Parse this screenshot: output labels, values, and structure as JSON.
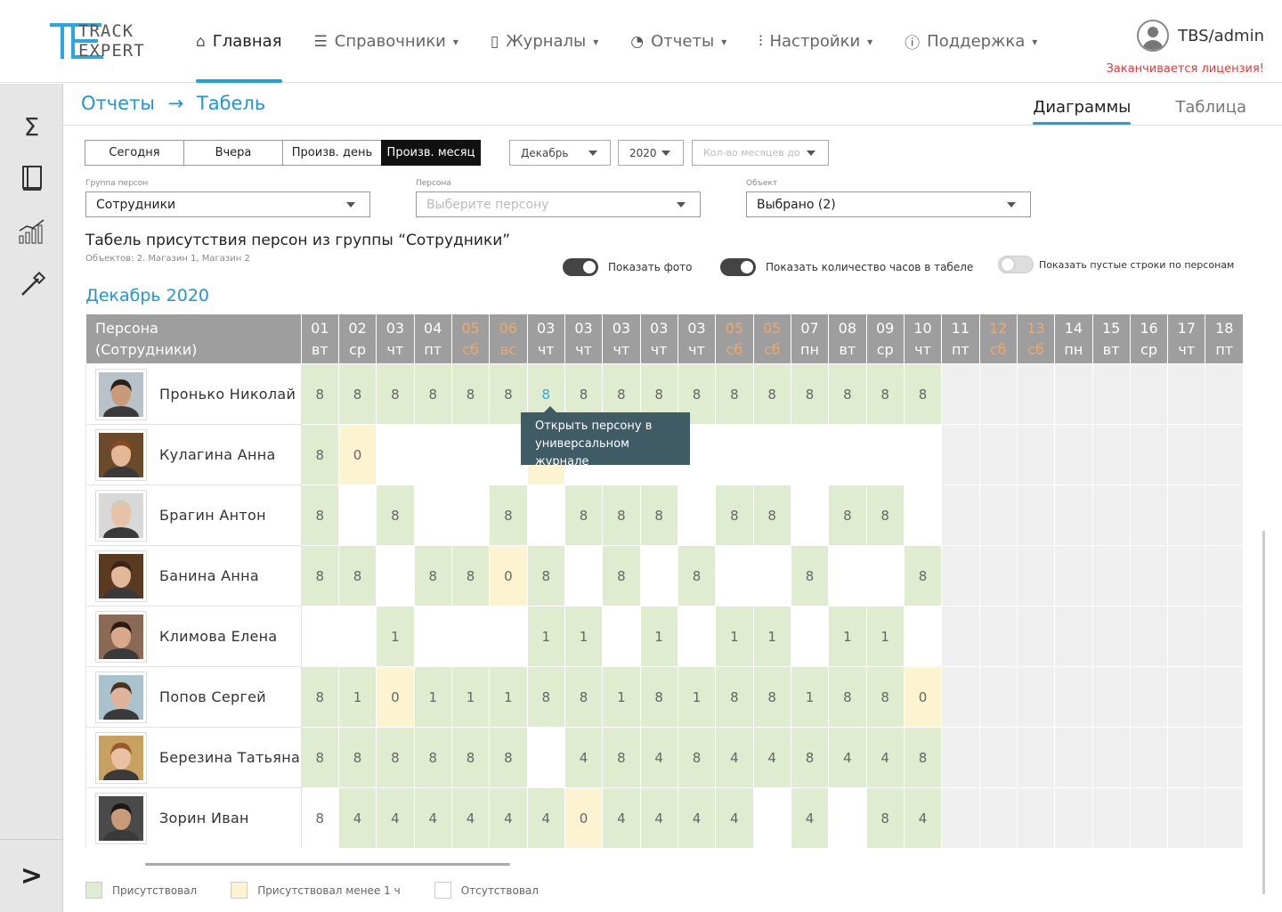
{
  "app": {
    "logo_line1": "TRACK",
    "logo_line2": "EXPERT",
    "user": "TBS/admin",
    "license_warning": "Заканчивается лицензия!"
  },
  "nav": [
    {
      "label": "Главная",
      "icon": "home-icon",
      "active": true
    },
    {
      "label": "Справочники",
      "icon": "list-icon"
    },
    {
      "label": "Журналы",
      "icon": "book-icon"
    },
    {
      "label": "Отчеты",
      "icon": "pie-chart-icon"
    },
    {
      "label": "Настройки",
      "icon": "sliders-icon"
    },
    {
      "label": "Поддержка",
      "icon": "help-icon"
    }
  ],
  "sidebar": [
    "sum-icon",
    "journal-icon",
    "analytics-icon",
    "tools-icon"
  ],
  "breadcrumb": {
    "part1": "Отчеты",
    "arrow": "→",
    "part2": "Табель"
  },
  "view_tabs": {
    "charts": "Диаграммы",
    "table": "Таблица"
  },
  "period_buttons": [
    "Сегодня",
    "Вчера",
    "Произв. день",
    "Произв. месяц"
  ],
  "filters": {
    "month": "Декабрь",
    "year": "2020",
    "months_count_placeholder": "Кол-во месяцев до",
    "group_label": "Группа персон",
    "group_value": "Сотрудники",
    "person_label": "Персона",
    "person_placeholder": "Выберите персону",
    "object_label": "Объект",
    "object_value": "Выбрано (2)"
  },
  "report": {
    "title": "Табель присутствия персон из группы “Сотрудники”",
    "subtitle": "Объектов: 2. Магазин 1, Магазин 2",
    "toggle_photo": "Показать фото",
    "toggle_hours": "Показать количество часов в табеле",
    "toggle_empty": "Показать пустые строки по персонам",
    "month_title": "Декабрь 2020"
  },
  "table": {
    "person_header_1": "Персона",
    "person_header_2": "(Сотрудники)",
    "columns": [
      {
        "d": "01",
        "w": "вт"
      },
      {
        "d": "02",
        "w": "ср"
      },
      {
        "d": "03",
        "w": "чт"
      },
      {
        "d": "04",
        "w": "пт"
      },
      {
        "d": "05",
        "w": "сб",
        "we": true
      },
      {
        "d": "06",
        "w": "вс",
        "we": true
      },
      {
        "d": "03",
        "w": "чт"
      },
      {
        "d": "03",
        "w": "чт"
      },
      {
        "d": "03",
        "w": "чт"
      },
      {
        "d": "03",
        "w": "чт"
      },
      {
        "d": "03",
        "w": "чт"
      },
      {
        "d": "05",
        "w": "сб",
        "we": true
      },
      {
        "d": "05",
        "w": "сб",
        "we": true
      },
      {
        "d": "07",
        "w": "пн"
      },
      {
        "d": "08",
        "w": "вт"
      },
      {
        "d": "09",
        "w": "ср"
      },
      {
        "d": "10",
        "w": "чт"
      },
      {
        "d": "11",
        "w": "пт"
      },
      {
        "d": "12",
        "w": "сб",
        "we": true
      },
      {
        "d": "13",
        "w": "сб",
        "we": true
      },
      {
        "d": "14",
        "w": "пн"
      },
      {
        "d": "15",
        "w": "вт"
      },
      {
        "d": "16",
        "w": "ср"
      },
      {
        "d": "17",
        "w": "чт"
      },
      {
        "d": "18",
        "w": "пт"
      }
    ],
    "rows": [
      {
        "name": "Пронько Николай",
        "cells": [
          [
            "8",
            "g"
          ],
          [
            "8",
            "g"
          ],
          [
            "8",
            "g"
          ],
          [
            "8",
            "g"
          ],
          [
            "8",
            "g"
          ],
          [
            "8",
            "g"
          ],
          [
            "8",
            "g"
          ],
          [
            "8",
            "g"
          ],
          [
            "8",
            "g"
          ],
          [
            "8",
            "g"
          ],
          [
            "8",
            "g"
          ],
          [
            "8",
            "g"
          ],
          [
            "8",
            "g"
          ],
          [
            "8",
            "g"
          ],
          [
            "8",
            "g"
          ],
          [
            "8",
            "g"
          ],
          [
            "8",
            "g"
          ]
        ]
      },
      {
        "name": "Кулагина Анна",
        "cells": [
          [
            "8",
            "g"
          ],
          [
            "0",
            "y"
          ],
          [
            "",
            "w"
          ],
          [
            "",
            "w"
          ],
          [
            "",
            "w"
          ],
          [
            "",
            "w"
          ],
          [
            "",
            "y"
          ],
          [
            "",
            "w"
          ],
          [
            "",
            "w"
          ],
          [
            "",
            "w"
          ],
          [
            "",
            "w"
          ],
          [
            "",
            "w"
          ],
          [
            "",
            "w"
          ],
          [
            "",
            "w"
          ],
          [
            "",
            "w"
          ],
          [
            "",
            "w"
          ],
          [
            "",
            "w"
          ]
        ]
      },
      {
        "name": "Брагин Антон",
        "cells": [
          [
            "8",
            "g"
          ],
          [
            "",
            "w"
          ],
          [
            "8",
            "g"
          ],
          [
            "",
            "w"
          ],
          [
            "",
            "w"
          ],
          [
            "8",
            "g"
          ],
          [
            "",
            "w"
          ],
          [
            "8",
            "g"
          ],
          [
            "8",
            "g"
          ],
          [
            "8",
            "g"
          ],
          [
            "",
            "w"
          ],
          [
            "8",
            "g"
          ],
          [
            "8",
            "g"
          ],
          [
            "",
            "w"
          ],
          [
            "8",
            "g"
          ],
          [
            "8",
            "g"
          ],
          [
            "",
            "w"
          ]
        ]
      },
      {
        "name": "Банина Анна",
        "cells": [
          [
            "8",
            "g"
          ],
          [
            "8",
            "g"
          ],
          [
            "",
            "w"
          ],
          [
            "8",
            "g"
          ],
          [
            "8",
            "g"
          ],
          [
            "0",
            "y"
          ],
          [
            "8",
            "g"
          ],
          [
            "",
            "w"
          ],
          [
            "8",
            "g"
          ],
          [
            "",
            "w"
          ],
          [
            "8",
            "g"
          ],
          [
            "",
            "w"
          ],
          [
            "",
            "w"
          ],
          [
            "8",
            "g"
          ],
          [
            "",
            "w"
          ],
          [
            "",
            "w"
          ],
          [
            "8",
            "g"
          ]
        ]
      },
      {
        "name": "Климова Елена",
        "cells": [
          [
            "",
            "w"
          ],
          [
            "",
            "w"
          ],
          [
            "1",
            "g"
          ],
          [
            "",
            "w"
          ],
          [
            "",
            "w"
          ],
          [
            "",
            "w"
          ],
          [
            "1",
            "g"
          ],
          [
            "1",
            "g"
          ],
          [
            "",
            "w"
          ],
          [
            "1",
            "g"
          ],
          [
            "",
            "w"
          ],
          [
            "1",
            "g"
          ],
          [
            "1",
            "g"
          ],
          [
            "",
            "w"
          ],
          [
            "1",
            "g"
          ],
          [
            "1",
            "g"
          ],
          [
            "",
            "w"
          ]
        ]
      },
      {
        "name": "Попов Сергей",
        "cells": [
          [
            "8",
            "g"
          ],
          [
            "1",
            "g"
          ],
          [
            "0",
            "y"
          ],
          [
            "1",
            "g"
          ],
          [
            "1",
            "g"
          ],
          [
            "1",
            "g"
          ],
          [
            "8",
            "g"
          ],
          [
            "8",
            "g"
          ],
          [
            "1",
            "g"
          ],
          [
            "8",
            "g"
          ],
          [
            "1",
            "g"
          ],
          [
            "8",
            "g"
          ],
          [
            "8",
            "g"
          ],
          [
            "1",
            "g"
          ],
          [
            "8",
            "g"
          ],
          [
            "8",
            "g"
          ],
          [
            "0",
            "y"
          ]
        ]
      },
      {
        "name": "Березина Татьяна",
        "cells": [
          [
            "8",
            "g"
          ],
          [
            "8",
            "g"
          ],
          [
            "8",
            "g"
          ],
          [
            "8",
            "g"
          ],
          [
            "8",
            "g"
          ],
          [
            "8",
            "g"
          ],
          [
            "",
            "w"
          ],
          [
            "4",
            "g"
          ],
          [
            "8",
            "g"
          ],
          [
            "4",
            "g"
          ],
          [
            "8",
            "g"
          ],
          [
            "4",
            "g"
          ],
          [
            "4",
            "g"
          ],
          [
            "8",
            "g"
          ],
          [
            "4",
            "g"
          ],
          [
            "4",
            "g"
          ],
          [
            "8",
            "g"
          ]
        ]
      },
      {
        "name": "Зорин Иван",
        "cells": [
          [
            "8",
            "w"
          ],
          [
            "4",
            "g"
          ],
          [
            "4",
            "g"
          ],
          [
            "4",
            "g"
          ],
          [
            "4",
            "g"
          ],
          [
            "4",
            "g"
          ],
          [
            "4",
            "g"
          ],
          [
            "0",
            "y"
          ],
          [
            "4",
            "g"
          ],
          [
            "4",
            "g"
          ],
          [
            "4",
            "g"
          ],
          [
            "4",
            "g"
          ],
          [
            "",
            "w"
          ],
          [
            "4",
            "g"
          ],
          [
            "",
            "w"
          ],
          [
            "8",
            "g"
          ],
          [
            "4",
            "g"
          ]
        ]
      }
    ]
  },
  "tooltip": {
    "line1": "Открыть персону в",
    "line2": "универсальном журнале"
  },
  "legend": {
    "present": "Присутствовал",
    "present_less": "Присутствовал менее 1 ч",
    "absent": "Отсутствовал"
  },
  "colors": {
    "accent": "#1e9fe0",
    "present": "#dfeccf",
    "partial": "#fcf3d0",
    "weekend": "#f2a86a",
    "warning": "#e23a3a"
  }
}
